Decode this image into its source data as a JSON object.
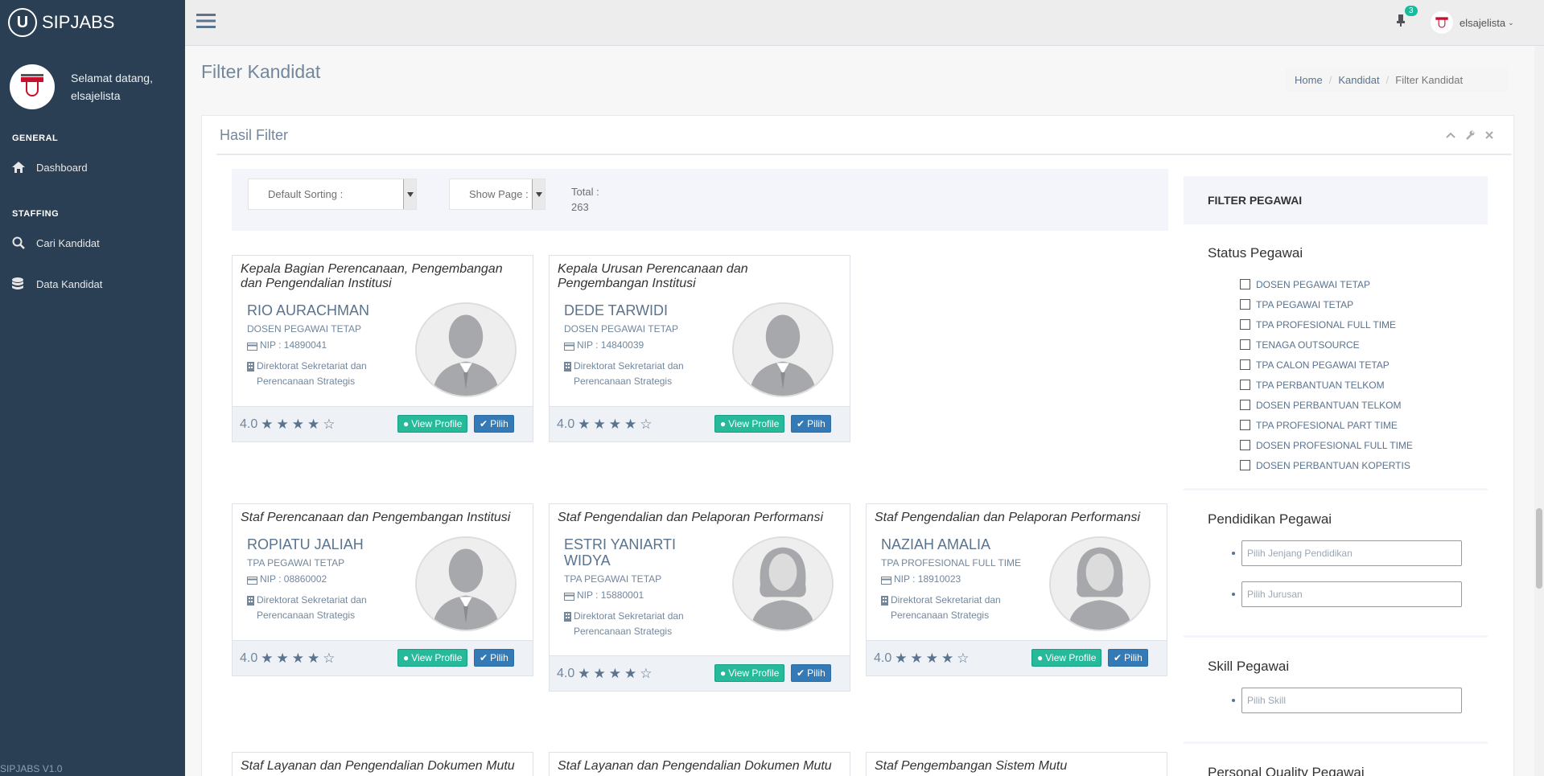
{
  "app": {
    "name": "SIPJABS",
    "logo_letter": "U",
    "version": "SIPJABS V1.0"
  },
  "sidebar": {
    "greeting": "Selamat datang,",
    "username": "elsajelista",
    "sections": [
      {
        "title": "GENERAL",
        "items": [
          {
            "label": "Dashboard",
            "icon": "home-icon"
          }
        ]
      },
      {
        "title": "STAFFING",
        "items": [
          {
            "label": "Cari Kandidat",
            "icon": "search-icon"
          },
          {
            "label": "Data Kandidat",
            "icon": "database-icon"
          }
        ]
      }
    ]
  },
  "topnav": {
    "notif_count": "3",
    "user": "elsajelista"
  },
  "page": {
    "title": "Filter Kandidat",
    "breadcrumb": [
      "Home",
      "Kandidat",
      "Filter Kandidat"
    ]
  },
  "panel": {
    "title": "Hasil Filter",
    "sorting_label": "Default Sorting :",
    "show_page_label": "Show Page :",
    "total_label": "Total :",
    "total_value": "263"
  },
  "cards": [
    {
      "role": "Kepala Bagian Perencanaan, Pengembangan dan Pengendalian Institusi",
      "name": "RIO AURACHMAN",
      "status": "DOSEN PEGAWAI TETAP",
      "nip": "NIP : 14890041",
      "unit": "Direktorat Sekretariat dan Perencanaan Strategis",
      "rating": "4.0",
      "gender": "male"
    },
    {
      "role": "Kepala Urusan Perencanaan dan Pengembangan Institusi",
      "name": "DEDE TARWIDI",
      "status": "DOSEN PEGAWAI TETAP",
      "nip": "NIP : 14840039",
      "unit": "Direktorat Sekretariat dan Perencanaan Strategis",
      "rating": "4.0",
      "gender": "male"
    },
    {
      "role": "Staf Perencanaan dan Pengembangan Institusi",
      "name": "ROPIATU JALIAH",
      "status": "TPA PEGAWAI TETAP",
      "nip": "NIP : 08860002",
      "unit": "Direktorat Sekretariat dan Perencanaan Strategis",
      "rating": "4.0",
      "gender": "male"
    },
    {
      "role": "Staf Pengendalian dan Pelaporan Performansi",
      "name": "ESTRI YANIARTI WIDYA",
      "status": "TPA PEGAWAI TETAP",
      "nip": "NIP : 15880001",
      "unit": "Direktorat Sekretariat dan Perencanaan Strategis",
      "rating": "4.0",
      "gender": "female"
    },
    {
      "role": "Staf Pengendalian dan Pelaporan Performansi",
      "name": "NAZIAH AMALIA",
      "status": "TPA PROFESIONAL FULL TIME",
      "nip": "NIP : 18910023",
      "unit": "Direktorat Sekretariat dan Perencanaan Strategis",
      "rating": "4.0",
      "gender": "female"
    },
    {
      "role": "Staf Layanan dan Pengendalian Dokumen Mutu"
    },
    {
      "role": "Staf Layanan dan Pengendalian Dokumen Mutu"
    },
    {
      "role": "Staf Pengembangan Sistem Mutu"
    }
  ],
  "buttons": {
    "view_profile": "View Profile",
    "pilih": "Pilih"
  },
  "filter": {
    "title": "FILTER PEGAWAI",
    "status_title": "Status Pegawai",
    "status_options": [
      "DOSEN PEGAWAI TETAP",
      "TPA PEGAWAI TETAP",
      "TPA PROFESIONAL FULL TIME",
      "TENAGA OUTSOURCE",
      "TPA CALON PEGAWAI TETAP",
      "TPA PERBANTUAN TELKOM",
      "DOSEN PERBANTUAN TELKOM",
      "TPA PROFESIONAL PART TIME",
      "DOSEN PROFESIONAL FULL TIME",
      "DOSEN PERBANTUAN KOPERTIS"
    ],
    "pendidikan_title": "Pendidikan Pegawai",
    "jenjang_placeholder": "Pilih Jenjang Pendidikan",
    "jurusan_placeholder": "Pilih Jurusan",
    "skill_title": "Skill Pegawai",
    "skill_placeholder": "Pilih Skill",
    "quality_title": "Personal Quality Pegawai"
  },
  "colors": {
    "sidebar_bg": "#2a3f54",
    "accent_green": "#26b99a",
    "accent_blue": "#337ab7",
    "badge": "#1abb9c"
  }
}
